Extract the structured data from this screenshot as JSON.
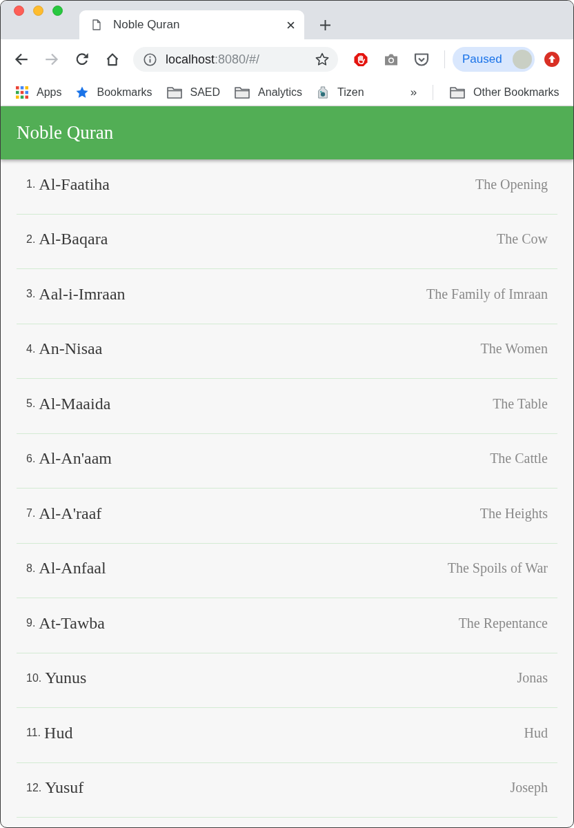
{
  "window": {
    "tab": {
      "title": "Noble Quran"
    }
  },
  "toolbar": {
    "nav": [
      {
        "kind": "back",
        "disabled": false
      },
      {
        "kind": "forward",
        "disabled": true
      },
      {
        "kind": "reload",
        "disabled": false
      },
      {
        "kind": "home",
        "disabled": false
      }
    ],
    "url": {
      "host": "localhost",
      "path": ":8080/#/"
    },
    "profile": {
      "label": "Paused"
    }
  },
  "bookmarks_bar": {
    "items": [
      {
        "kind": "apps",
        "label": "Apps"
      },
      {
        "kind": "star",
        "label": "Bookmarks"
      },
      {
        "kind": "folder",
        "label": "SAED"
      },
      {
        "kind": "folder",
        "label": "Analytics"
      },
      {
        "kind": "app",
        "label": "Tizen"
      }
    ],
    "overflow": "»",
    "other": {
      "kind": "folder",
      "label": "Other Bookmarks"
    }
  },
  "app_bar": {
    "title": "Noble Quran"
  },
  "surahs": [
    {
      "number": "1.",
      "name": "Al-Faatiha",
      "translation": "The Opening"
    },
    {
      "number": "2.",
      "name": "Al-Baqara",
      "translation": "The Cow"
    },
    {
      "number": "3.",
      "name": "Aal-i-Imraan",
      "translation": "The Family of Imraan"
    },
    {
      "number": "4.",
      "name": "An-Nisaa",
      "translation": "The Women"
    },
    {
      "number": "5.",
      "name": "Al-Maaida",
      "translation": "The Table"
    },
    {
      "number": "6.",
      "name": "Al-An'aam",
      "translation": "The Cattle"
    },
    {
      "number": "7.",
      "name": "Al-A'raaf",
      "translation": "The Heights"
    },
    {
      "number": "8.",
      "name": "Al-Anfaal",
      "translation": "The Spoils of War"
    },
    {
      "number": "9.",
      "name": "At-Tawba",
      "translation": "The Repentance"
    },
    {
      "number": "10.",
      "name": "Yunus",
      "translation": "Jonas"
    },
    {
      "number": "11.",
      "name": "Hud",
      "translation": "Hud"
    },
    {
      "number": "12.",
      "name": "Yusuf",
      "translation": "Joseph"
    }
  ]
}
